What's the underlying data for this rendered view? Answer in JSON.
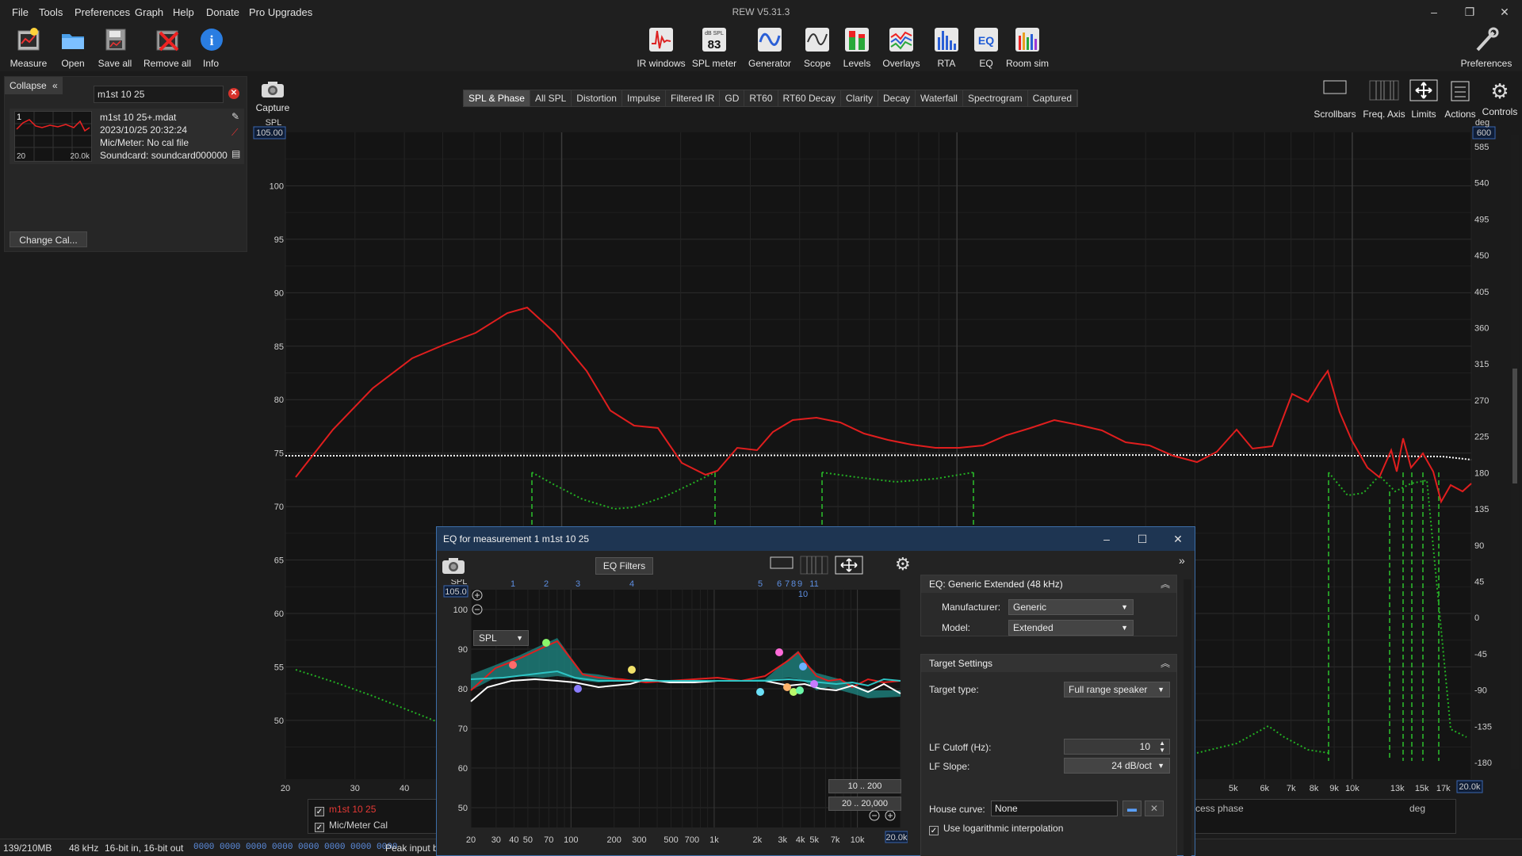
{
  "app": {
    "title": "REW V5.31.3",
    "menu": [
      "File",
      "Tools",
      "Preferences",
      "Graph",
      "Help",
      "Donate",
      "Pro Upgrades"
    ]
  },
  "toolbar": {
    "left": [
      {
        "label": "Measure",
        "icon": "measure-icon"
      },
      {
        "label": "Open",
        "icon": "open-folder-icon"
      },
      {
        "label": "Save all",
        "icon": "save-icon"
      },
      {
        "label": "Remove all",
        "icon": "remove-icon"
      },
      {
        "label": "Info",
        "icon": "info-icon"
      }
    ],
    "center": [
      {
        "label": "IR windows",
        "icon": "ir-windows-icon"
      },
      {
        "label": "SPL meter",
        "icon": "spl-meter-icon",
        "badge_top": "dB SPL",
        "badge_value": "83"
      },
      {
        "label": "Generator",
        "icon": "generator-icon"
      },
      {
        "label": "Scope",
        "icon": "scope-icon"
      },
      {
        "label": "Levels",
        "icon": "levels-icon"
      },
      {
        "label": "Overlays",
        "icon": "overlays-icon"
      },
      {
        "label": "RTA",
        "icon": "rta-icon"
      },
      {
        "label": "EQ",
        "icon": "eq-icon"
      },
      {
        "label": "Room sim",
        "icon": "room-sim-icon"
      }
    ],
    "right": {
      "label": "Preferences",
      "icon": "preferences-icon"
    }
  },
  "left_panel": {
    "collapse_label": "Collapse",
    "measurement_name": "m1st 10 25",
    "entry": {
      "index": "1",
      "file": "m1st 10 25+.mdat",
      "date": "2023/10/25 20:32:24",
      "mic": "Mic/Meter: No cal file",
      "soundcard": "Soundcard: soundcard000000",
      "thumb_lo": "20",
      "thumb_hi": "20.0k"
    },
    "change_cal_label": "Change Cal..."
  },
  "capture_label": "Capture",
  "graph_tabs": [
    "SPL & Phase",
    "All SPL",
    "Distortion",
    "Impulse",
    "Filtered IR",
    "GD",
    "RT60",
    "RT60 Decay",
    "Clarity",
    "Decay",
    "Waterfall",
    "Spectrogram",
    "Captured"
  ],
  "active_tab": "SPL & Phase",
  "right_controls": [
    "Scrollbars",
    "Freq. Axis",
    "Limits",
    "Actions",
    "Controls"
  ],
  "main_graph": {
    "left_unit": "SPL",
    "right_unit": "deg",
    "left_top_value": "105.00",
    "right_top_value": "600",
    "x_right_value": "20.0k",
    "y_left_ticks": [
      "100",
      "95",
      "90",
      "85",
      "80",
      "75",
      "70",
      "65",
      "60",
      "55",
      "50"
    ],
    "y_right_ticks": [
      "585",
      "540",
      "495",
      "450",
      "405",
      "360",
      "315",
      "270",
      "225",
      "180",
      "135",
      "90",
      "45",
      "0",
      "-45",
      "-90",
      "-135",
      "-180"
    ],
    "x_ticks_left": [
      "20",
      "30",
      "40"
    ],
    "x_ticks_right": [
      "5k",
      "6k",
      "7k",
      "8k",
      "9k",
      "10k",
      "13k",
      "15k",
      "17k"
    ],
    "colors": {
      "spl": "#e01e1e",
      "target": "#ffffff",
      "phase": "#23b023",
      "eq_filter": "#1fbf1f"
    }
  },
  "legend": {
    "items": [
      {
        "label": "m1st 10 25",
        "color": "#e53935",
        "checked": "✓"
      },
      {
        "label": "Mic/Meter Cal",
        "color": "#cfcfcf",
        "checked": "✓"
      }
    ],
    "phase_label": "cess phase",
    "phase_unit": "deg"
  },
  "statusbar": {
    "memory": "139/210MB",
    "rate": "48 kHz",
    "bits": "16-bit in, 16-bit out",
    "meter": "0000 0000  0000 0000  0000 0000  0000 0000",
    "peak": "Peak input b"
  },
  "eq_dialog": {
    "title": "EQ for measurement 1 m1st 10 25",
    "filters_button": "EQ Filters",
    "spl_select": "SPL",
    "top_value": "105.0",
    "unit": "SPL",
    "x_right_value": "20.0k",
    "filter_numbers": [
      "1",
      "2",
      "3",
      "4",
      "5",
      "6",
      "7",
      "8",
      "9",
      "10",
      "11"
    ],
    "y_ticks": [
      "100",
      "90",
      "80",
      "70",
      "60",
      "50"
    ],
    "x_ticks": [
      "20",
      "30",
      "40",
      "50",
      "70",
      "100",
      "200",
      "300",
      "500",
      "700",
      "1k",
      "2k",
      "3k",
      "4k",
      "5k",
      "7k",
      "10k"
    ],
    "range_buttons": [
      "10 .. 200",
      "20 .. 20,000"
    ],
    "eq_panel": {
      "header": "EQ: Generic Extended (48 kHz)",
      "manufacturer_label": "Manufacturer:",
      "manufacturer": "Generic",
      "model_label": "Model:",
      "model": "Extended"
    },
    "target_panel": {
      "header": "Target Settings",
      "target_type_label": "Target type:",
      "target_type": "Full range speaker",
      "lf_cutoff_label": "LF Cutoff (Hz):",
      "lf_cutoff": "10",
      "lf_slope_label": "LF Slope:",
      "lf_slope": "24 dB/oct",
      "house_curve_label": "House curve:",
      "house_curve": "None",
      "log_interp_label": "Use logarithmic interpolation",
      "log_interp_checked": "✓"
    }
  }
}
